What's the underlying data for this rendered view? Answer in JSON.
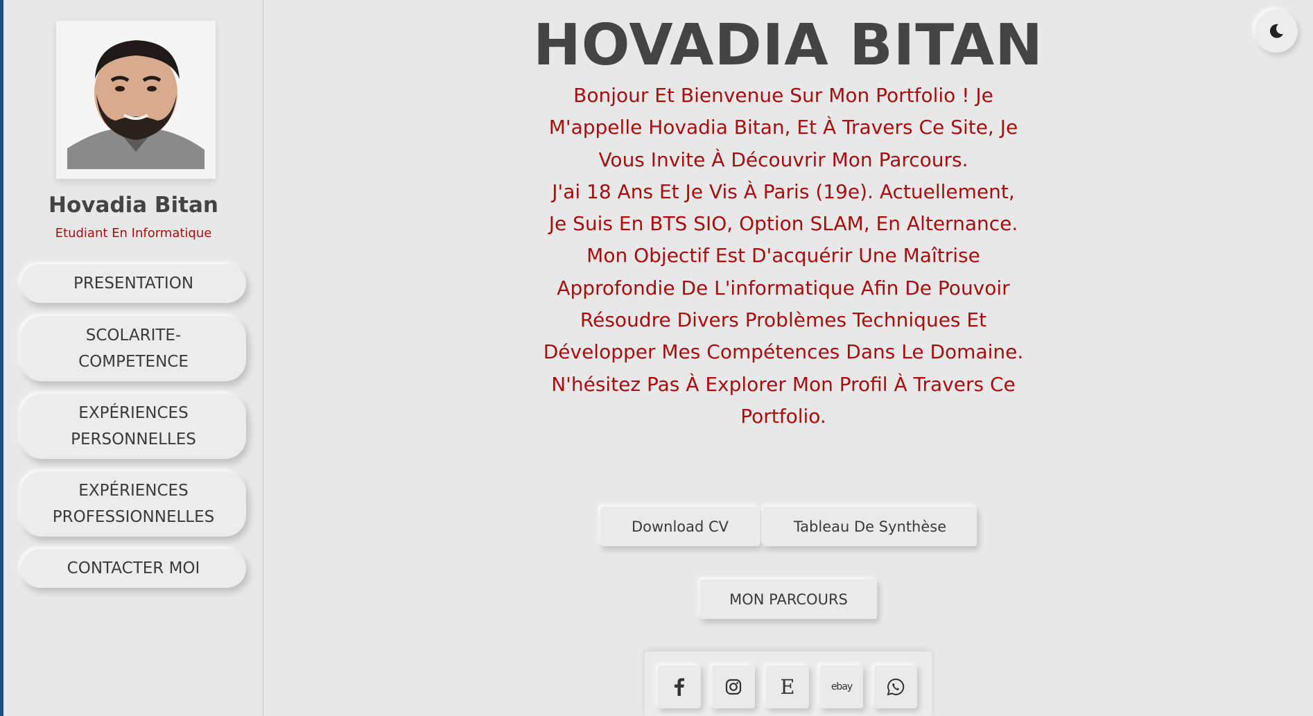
{
  "sidebar": {
    "name": "Hovadia Bitan",
    "role": "Etudiant En Informatique",
    "nav": [
      {
        "label": "PRESENTATION"
      },
      {
        "label": "SCOLARITE-\nCOMPETENCE"
      },
      {
        "label": "EXPÉRIENCES\nPERSONNELLES"
      },
      {
        "label": "EXPÉRIENCES\nPROFESSIONNELLES"
      },
      {
        "label": "CONTACTER MOI"
      }
    ]
  },
  "main": {
    "title": "HOVADIA BITAN",
    "intro": [
      "Bonjour Et Bienvenue Sur Mon Portfolio ! Je M'appelle Hovadia Bitan, Et À Travers Ce Site, Je Vous Invite À Découvrir Mon Parcours.",
      "J'ai 18 Ans Et Je Vis À Paris (19e). Actuellement, Je Suis En BTS SIO, Option SLAM, En Alternance.",
      "Mon Objectif Est D'acquérir Une Maîtrise Approfondie De L'informatique Afin De Pouvoir Résoudre Divers Problèmes Techniques Et Développer Mes Compétences Dans Le Domaine.",
      "N'hésitez Pas À Explorer Mon Profil À Travers Ce Portfolio."
    ],
    "download_cv": "Download CV",
    "synthese": "Tableau De Synthèse",
    "parcours": "MON PARCOURS",
    "social": [
      {
        "icon": "facebook-icon"
      },
      {
        "icon": "instagram-icon"
      },
      {
        "icon": "etsy-icon",
        "glyph": "E"
      },
      {
        "icon": "ebay-icon",
        "glyph": "ebay"
      },
      {
        "icon": "whatsapp-icon"
      }
    ]
  },
  "colors": {
    "accent": "#a80d0d",
    "text": "#444444",
    "background": "#e8e8e8"
  }
}
